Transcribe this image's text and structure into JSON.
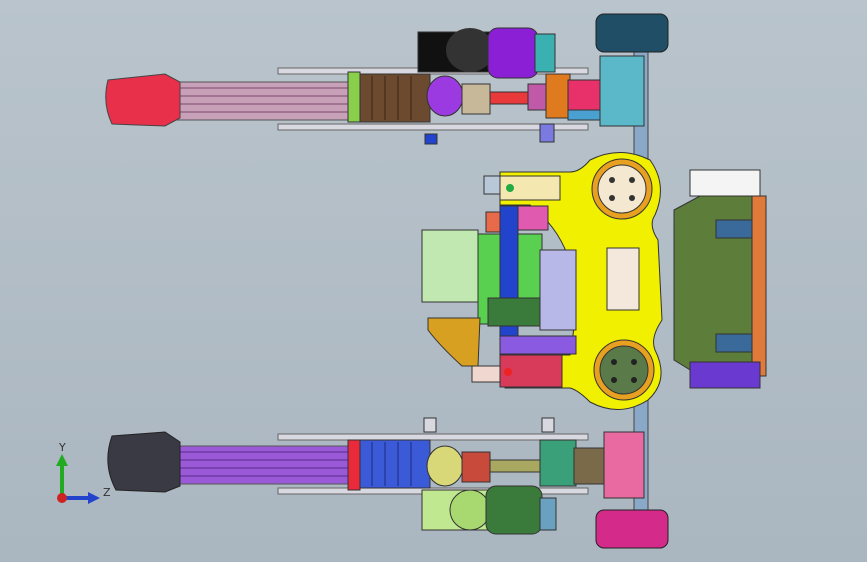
{
  "viewport": {
    "background_top": "#b9c4cc",
    "background_bottom": "#aab6c0"
  },
  "triad": {
    "y_label": "Y",
    "z_label": "Z",
    "y_color": "#22aa22",
    "z_color": "#2244cc",
    "x_color": "#cc2222"
  },
  "model": {
    "icon": "cad-assembly-icon",
    "colors": {
      "yellow_frame": "#f0f000",
      "red_grip": "#e8304a",
      "black_grip": "#3a3a44",
      "purple_motor": "#8a1fd6",
      "green_block": "#5d7d3a",
      "orange": "#e07a1e",
      "teal_wheel": "#1f6e86",
      "magenta_wheel": "#d42a8a",
      "light_blue": "#3b67d9"
    }
  }
}
